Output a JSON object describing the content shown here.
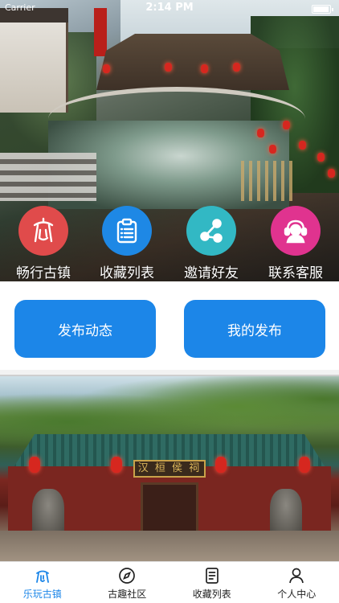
{
  "status_bar": {
    "carrier": "Carrier",
    "time": "2:14 PM"
  },
  "quick_actions": [
    {
      "label": "畅行古镇",
      "icon": "ancient-town-icon",
      "color": "#e04b4b"
    },
    {
      "label": "收藏列表",
      "icon": "clipboard-list-icon",
      "color": "#1e88e5"
    },
    {
      "label": "邀请好友",
      "icon": "share-icon",
      "color": "#32b8c4"
    },
    {
      "label": "联系客服",
      "icon": "customer-service-icon",
      "color": "#e0338f"
    }
  ],
  "publish": {
    "post_label": "发布动态",
    "my_posts_label": "我的发布"
  },
  "feature": {
    "sign_text": "汉 桓 侯 祠"
  },
  "tabbar": {
    "items": [
      {
        "label": "乐玩古镇",
        "icon": "home-pavilion-icon",
        "active": true
      },
      {
        "label": "古趣社区",
        "icon": "compass-icon",
        "active": false
      },
      {
        "label": "收藏列表",
        "icon": "document-icon",
        "active": false
      },
      {
        "label": "个人中心",
        "icon": "person-icon",
        "active": false
      }
    ]
  },
  "colors": {
    "accent": "#1c86e8",
    "tab_inactive": "#222222"
  }
}
